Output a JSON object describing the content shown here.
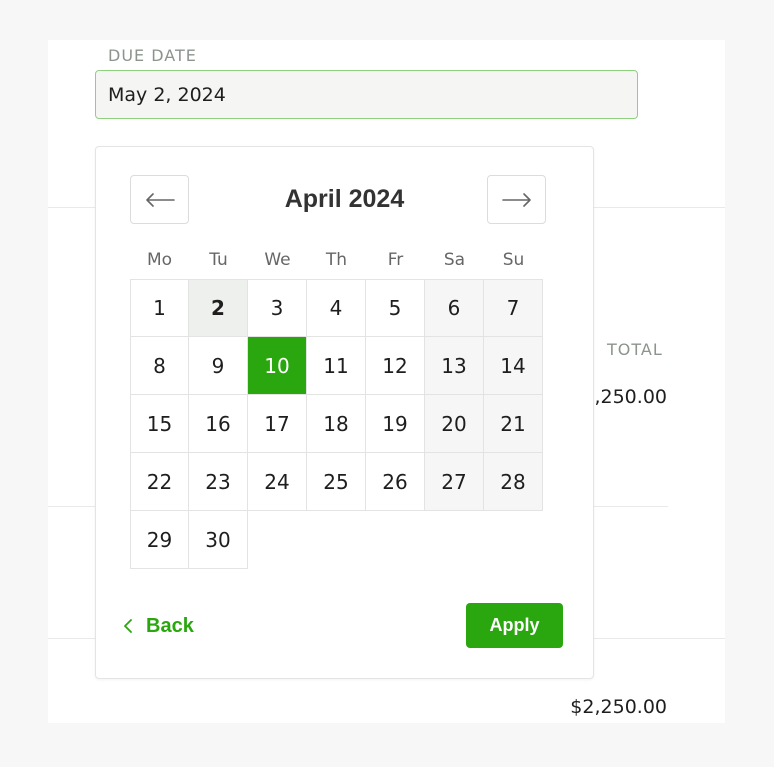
{
  "due_date": {
    "label": "DUE DATE",
    "value": "May 2, 2024"
  },
  "totals": {
    "label": "TOTAL",
    "row_value": ",250.00",
    "bottom_value": "$2,250.00"
  },
  "calendar": {
    "month_label": "April 2024",
    "weekdays": [
      "Mo",
      "Tu",
      "We",
      "Th",
      "Fr",
      "Sa",
      "Su"
    ],
    "days": [
      "1",
      "2",
      "3",
      "4",
      "5",
      "6",
      "7",
      "8",
      "9",
      "10",
      "11",
      "12",
      "13",
      "14",
      "15",
      "16",
      "17",
      "18",
      "19",
      "20",
      "21",
      "22",
      "23",
      "24",
      "25",
      "26",
      "27",
      "28",
      "29",
      "30"
    ],
    "today": "2",
    "selected": "10",
    "first_weekday_index": 0,
    "prev_icon": "arrow-left-icon",
    "next_icon": "arrow-right-icon"
  },
  "footer": {
    "back_label": "Back",
    "back_icon": "chevron-left-icon",
    "apply_label": "Apply"
  },
  "colors": {
    "accent": "#2aa60f",
    "input_border": "#8fd07f",
    "today_bg": "#edf0ec",
    "weekend_bg": "#f6f6f6"
  }
}
